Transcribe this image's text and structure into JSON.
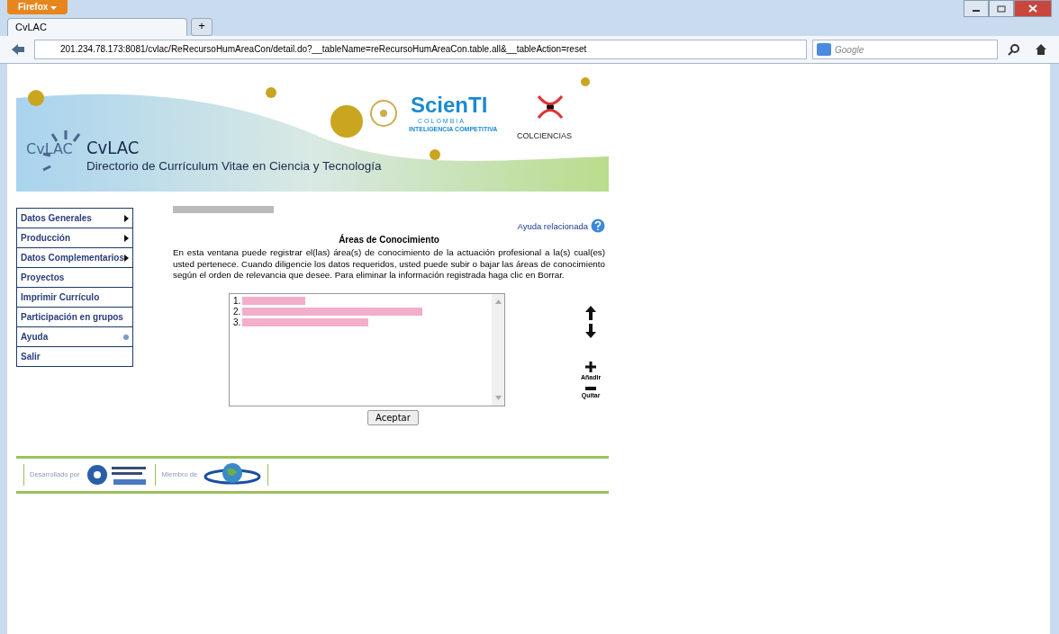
{
  "browser": {
    "app_button": "Firefox",
    "tabs": [
      {
        "title": "CvLAC",
        "selected": true
      }
    ],
    "new_tab": "+",
    "url": "201.234.78.173:8081/cvlac/ReRecursoHumAreaCon/detail.do?__tableName=reRecursoHumAreaCon.table.all&__tableAction=reset",
    "search_placeholder": "Google"
  },
  "banner": {
    "logo_text": "CvLAC",
    "title": "CvLAC",
    "subtitle": "Directorio de Currículum Vitae en Ciencia y Tecnología",
    "partner_name": "ScienTI",
    "partner_country": "COLOMBIA",
    "partner_tagline": "INTELIGENCIA COMPETITIVA",
    "sponsor": "COLCIENCIAS"
  },
  "menu": [
    {
      "label": "Datos Generales",
      "kind": "submenu"
    },
    {
      "label": "Producción",
      "kind": "submenu"
    },
    {
      "label": "Datos Complementarios",
      "kind": "submenu"
    },
    {
      "label": "Proyectos",
      "kind": "plain"
    },
    {
      "label": "Imprimir Currículo",
      "kind": "plain"
    },
    {
      "label": "Participación en grupos",
      "kind": "plain"
    },
    {
      "label": "Ayuda",
      "kind": "help"
    },
    {
      "label": "Salir",
      "kind": "plain"
    }
  ],
  "help_link": "Ayuda relacionada",
  "heading": "Áreas de Conocimiento",
  "description": "En esta ventana puede registrar el(las) área(s) de conocimiento de la actuación profesional a la(s) cual(es) usted pertenece. Cuando diligencie los datos requeridos, usted puede subir o bajar las áreas de conocimiento según el orden de relevancia que desee. Para eliminar la información registrada haga clic en Borrar.",
  "areas": [
    {
      "number": "1."
    },
    {
      "number": "2."
    },
    {
      "number": "3."
    }
  ],
  "actions": [
    {
      "label": "Añadir",
      "kind": "add"
    },
    {
      "label": "Quitar",
      "kind": "remove"
    }
  ],
  "accept_button": "Aceptar",
  "footer": {
    "developed_by": "Desarrollado por",
    "member_of": "Miembro de"
  }
}
